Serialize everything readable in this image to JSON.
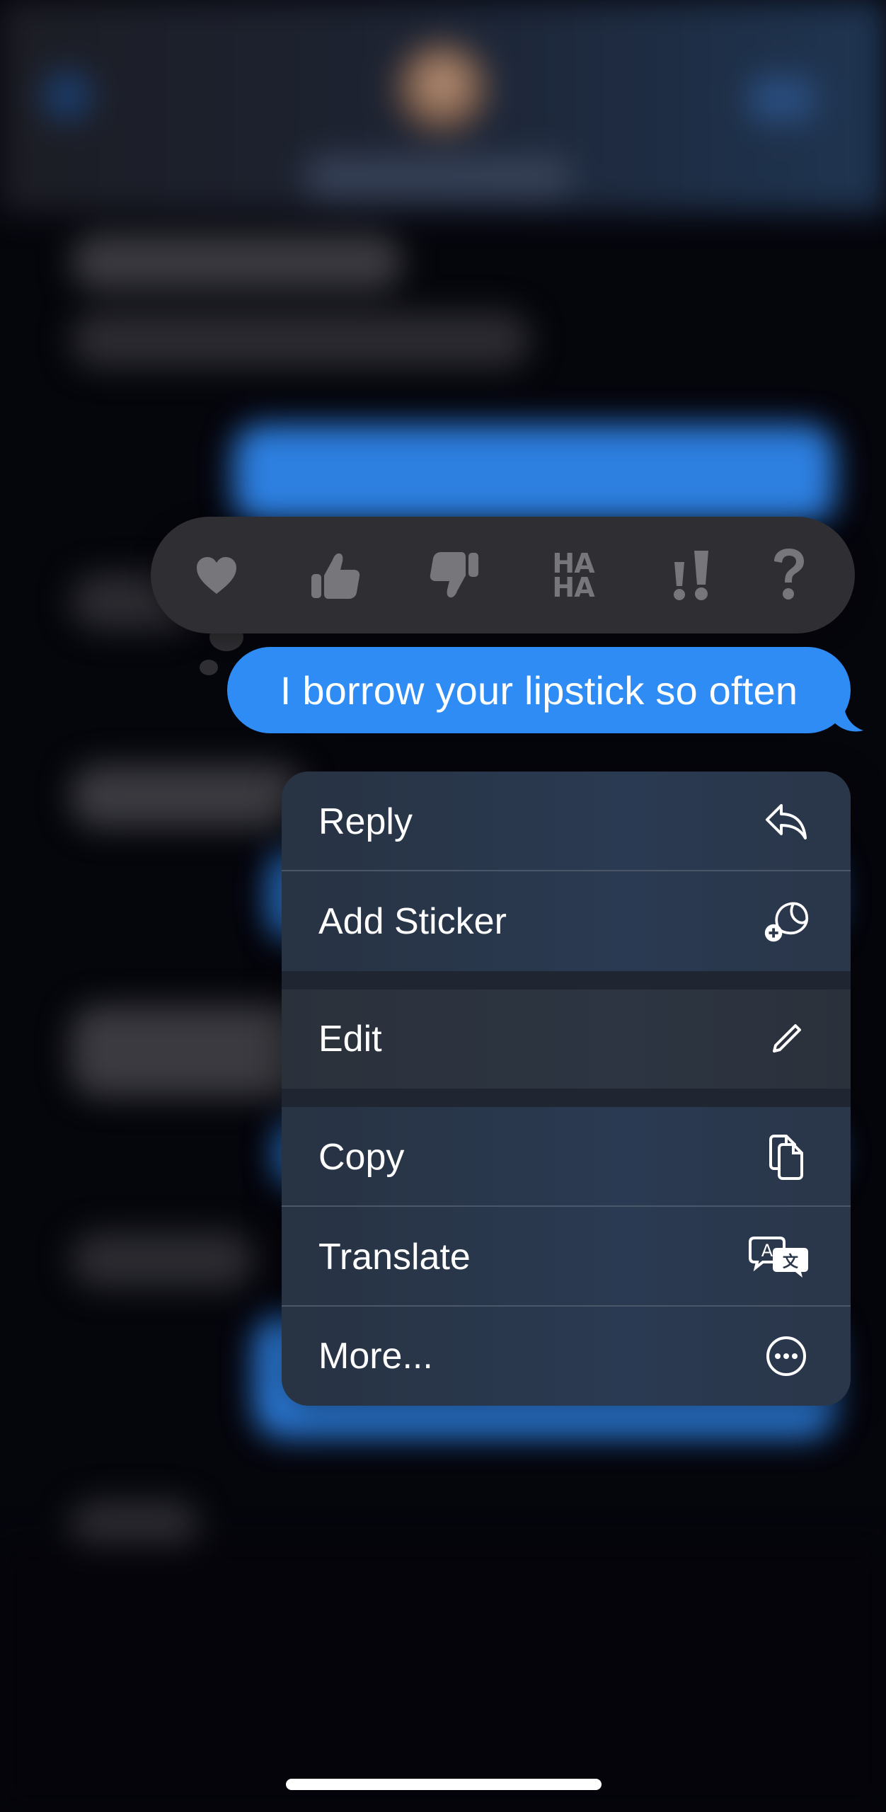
{
  "message": {
    "text": "I borrow your lipstick so often",
    "bubble_color": "#2f8cf4"
  },
  "reactions": [
    {
      "name": "heart"
    },
    {
      "name": "thumbs-up"
    },
    {
      "name": "thumbs-down"
    },
    {
      "name": "haha",
      "glyph_top": "HA",
      "glyph_bottom": "HA"
    },
    {
      "name": "exclamation"
    },
    {
      "name": "question"
    }
  ],
  "menu": {
    "items": [
      {
        "label": "Reply",
        "icon": "reply-icon"
      },
      {
        "label": "Add Sticker",
        "icon": "sticker-icon"
      },
      {
        "label": "Edit",
        "icon": "pencil-icon"
      },
      {
        "label": "Copy",
        "icon": "copy-icon"
      },
      {
        "label": "Translate",
        "icon": "translate-icon"
      },
      {
        "label": "More...",
        "icon": "ellipsis-circle-icon"
      }
    ]
  },
  "colors": {
    "background": "#05050c",
    "reaction_bar": "#2f2f33",
    "reaction_icon": "#77777b",
    "menu_background": "#2a3546",
    "accent_blue": "#2f8cf4"
  }
}
